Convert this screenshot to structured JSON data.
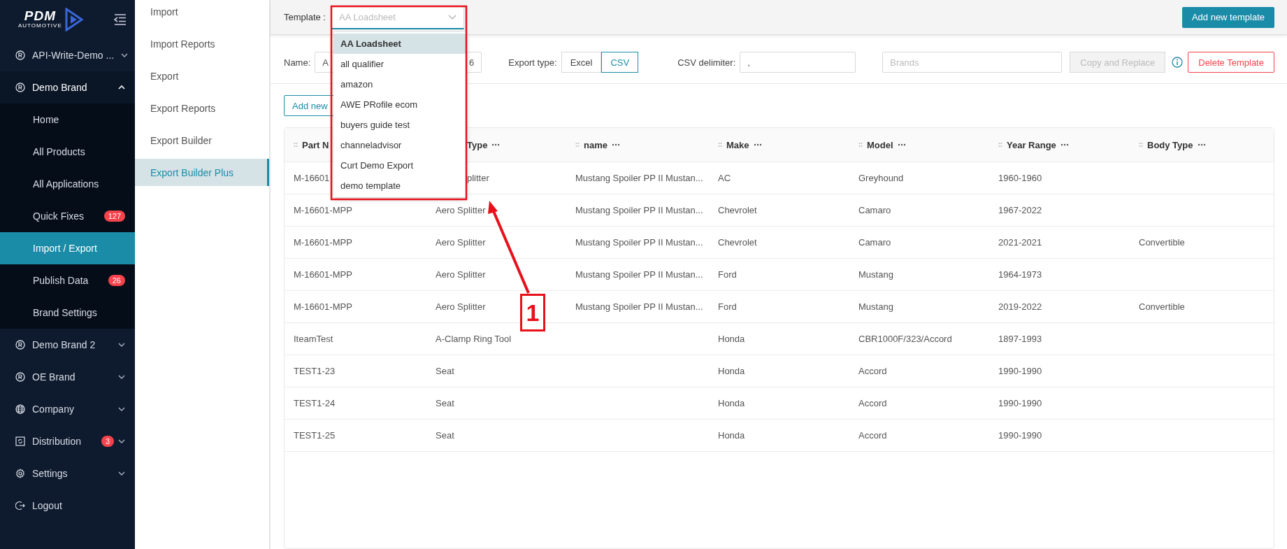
{
  "sidebar": {
    "logo": {
      "name": "PDM",
      "tagline": "AUTOMOTIVE"
    },
    "items": [
      {
        "label": "API-Write-Demo ...",
        "kind": "brand",
        "expanded": false
      },
      {
        "label": "Demo Brand",
        "kind": "brand",
        "expanded": true,
        "children": [
          {
            "label": "Home",
            "selected": false
          },
          {
            "label": "All Products",
            "selected": false
          },
          {
            "label": "All Applications",
            "selected": false
          },
          {
            "label": "Quick Fixes",
            "selected": false,
            "badge": "127"
          },
          {
            "label": "Import / Export",
            "selected": true
          },
          {
            "label": "Publish Data",
            "selected": false,
            "badge": "26"
          },
          {
            "label": "Brand Settings",
            "selected": false
          }
        ]
      },
      {
        "label": "Demo Brand 2",
        "kind": "brand",
        "expanded": false
      },
      {
        "label": "OE Brand",
        "kind": "brand",
        "expanded": false
      },
      {
        "label": "Company",
        "kind": "company",
        "expanded": false
      },
      {
        "label": "Distribution",
        "kind": "distribution",
        "expanded": false,
        "badge": "3"
      },
      {
        "label": "Settings",
        "kind": "settings",
        "expanded": false
      },
      {
        "label": "Logout",
        "kind": "logout"
      }
    ]
  },
  "submenu": [
    {
      "label": "Import",
      "selected": false
    },
    {
      "label": "Import Reports",
      "selected": false
    },
    {
      "label": "Export",
      "selected": false
    },
    {
      "label": "Export Reports",
      "selected": false
    },
    {
      "label": "Export Builder",
      "selected": false
    },
    {
      "label": "Export Builder Plus",
      "selected": true
    }
  ],
  "header": {
    "template_label": "Template :",
    "template_select": {
      "placeholder": "AA Loadsheet",
      "expanded": true,
      "options": [
        {
          "label": "AA Loadsheet",
          "selected": true
        },
        {
          "label": "all qualifier",
          "selected": false
        },
        {
          "label": "amazon",
          "selected": false
        },
        {
          "label": "AWE PRofile ecom",
          "selected": false
        },
        {
          "label": "buyers guide test",
          "selected": false
        },
        {
          "label": "channeladvisor",
          "selected": false
        },
        {
          "label": "Curt Demo Export",
          "selected": false
        },
        {
          "label": "demo template",
          "selected": false
        }
      ]
    },
    "add_button": "Add new template"
  },
  "settings": {
    "name_label": "Name:",
    "name_value_start": "A",
    "name_value_end": "6",
    "export_type_label": "Export type:",
    "export_types": [
      {
        "label": "Excel",
        "selected": false
      },
      {
        "label": "CSV",
        "selected": true
      }
    ],
    "delimiter_label": "CSV delimiter:",
    "delimiter_value": ",",
    "brands_placeholder": "Brands",
    "copy_button": {
      "label": "Copy and Replace",
      "disabled": true
    },
    "delete_button": "Delete Template"
  },
  "add_column_button": "Add new",
  "table": {
    "columns": [
      {
        "label": "Part N",
        "handle": true,
        "menu": false
      },
      {
        "label": "Type",
        "handle": false,
        "menu": true,
        "cut_start": true
      },
      {
        "label": "name",
        "handle": true,
        "menu": true
      },
      {
        "label": "Make",
        "handle": true,
        "menu": true
      },
      {
        "label": "Model",
        "handle": true,
        "menu": true
      },
      {
        "label": "Year Range",
        "handle": true,
        "menu": true
      },
      {
        "label": "Body Type",
        "handle": true,
        "menu": true
      }
    ],
    "rows": [
      [
        {
          "text": "M-16601"
        },
        {
          "text": "plitter",
          "cut_start": true
        },
        {
          "text": "Mustang Spoiler PP II Mustan..."
        },
        {
          "text": "AC"
        },
        {
          "text": "Greyhound"
        },
        {
          "text": "1960-1960"
        },
        {
          "text": ""
        }
      ],
      [
        {
          "text": "M-16601-MPP"
        },
        {
          "text": "Aero Splitter"
        },
        {
          "text": "Mustang Spoiler PP II Mustan..."
        },
        {
          "text": "Chevrolet"
        },
        {
          "text": "Camaro"
        },
        {
          "text": "1967-2022"
        },
        {
          "text": ""
        }
      ],
      [
        {
          "text": "M-16601-MPP"
        },
        {
          "text": "Aero Splitter"
        },
        {
          "text": "Mustang Spoiler PP II Mustan..."
        },
        {
          "text": "Chevrolet"
        },
        {
          "text": "Camaro"
        },
        {
          "text": "2021-2021"
        },
        {
          "text": "Convertible"
        }
      ],
      [
        {
          "text": "M-16601-MPP"
        },
        {
          "text": "Aero Splitter"
        },
        {
          "text": "Mustang Spoiler PP II Mustan..."
        },
        {
          "text": "Ford"
        },
        {
          "text": "Mustang"
        },
        {
          "text": "1964-1973"
        },
        {
          "text": ""
        }
      ],
      [
        {
          "text": "M-16601-MPP"
        },
        {
          "text": "Aero Splitter"
        },
        {
          "text": "Mustang Spoiler PP II Mustan..."
        },
        {
          "text": "Ford"
        },
        {
          "text": "Mustang"
        },
        {
          "text": "2019-2022"
        },
        {
          "text": "Convertible"
        }
      ],
      [
        {
          "text": "IteamTest"
        },
        {
          "text": "A-Clamp Ring Tool"
        },
        {
          "text": ""
        },
        {
          "text": "Honda"
        },
        {
          "text": "CBR1000F/323/Accord"
        },
        {
          "text": "1897-1993"
        },
        {
          "text": ""
        }
      ],
      [
        {
          "text": "TEST1-23"
        },
        {
          "text": "Seat"
        },
        {
          "text": ""
        },
        {
          "text": "Honda"
        },
        {
          "text": "Accord"
        },
        {
          "text": "1990-1990"
        },
        {
          "text": ""
        }
      ],
      [
        {
          "text": "TEST1-24"
        },
        {
          "text": "Seat"
        },
        {
          "text": ""
        },
        {
          "text": "Honda"
        },
        {
          "text": "Accord"
        },
        {
          "text": "1990-1990"
        },
        {
          "text": ""
        }
      ],
      [
        {
          "text": "TEST1-25"
        },
        {
          "text": "Seat"
        },
        {
          "text": ""
        },
        {
          "text": "Honda"
        },
        {
          "text": "Accord"
        },
        {
          "text": "1990-1990"
        },
        {
          "text": ""
        }
      ]
    ]
  },
  "annotation": {
    "label": "1"
  }
}
